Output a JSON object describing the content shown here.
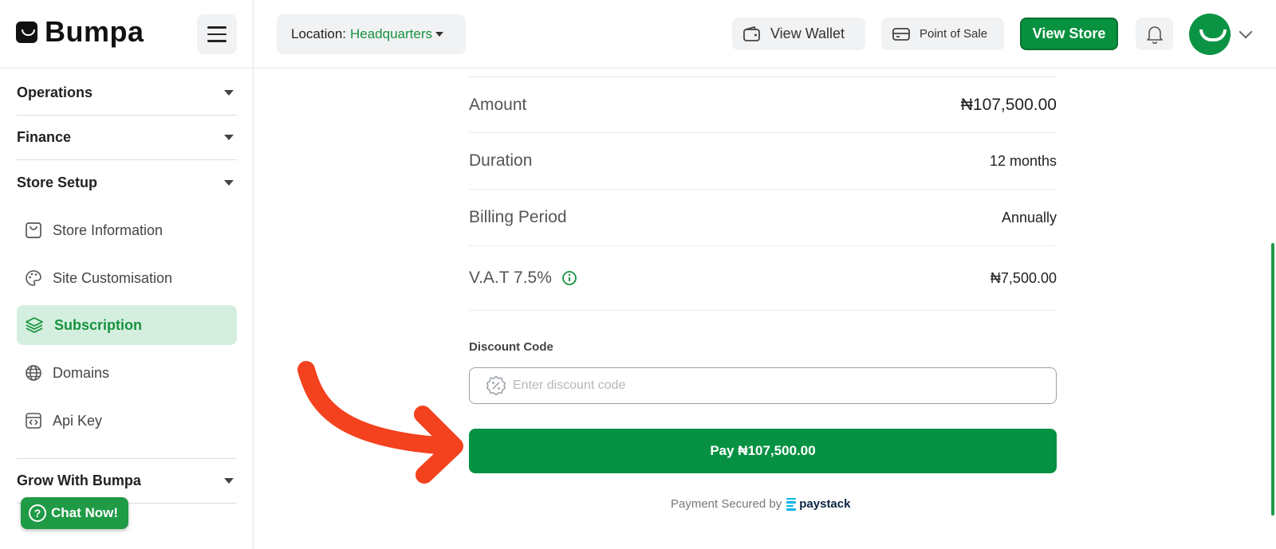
{
  "brand": {
    "name": "Bumpa"
  },
  "header": {
    "location_label": "Location:",
    "location_value": "Headquarters",
    "wallet_label": "View Wallet",
    "pos_label": "Point of Sale",
    "store_label": "View Store"
  },
  "sidebar": {
    "sections": [
      {
        "label": "Operations"
      },
      {
        "label": "Finance"
      },
      {
        "label": "Store Setup"
      },
      {
        "label": "Grow With Bumpa"
      }
    ],
    "items": [
      {
        "label": "Store Information",
        "icon": "store-icon"
      },
      {
        "label": "Site Customisation",
        "icon": "palette-icon"
      },
      {
        "label": "Subscription",
        "icon": "layers-icon",
        "active": true
      },
      {
        "label": "Domains",
        "icon": "globe-icon"
      },
      {
        "label": "Api Key",
        "icon": "code-icon"
      }
    ],
    "chat_label": "Chat Now!"
  },
  "summary": {
    "amount_label": "Amount",
    "amount_value": "₦107,500.00",
    "duration_label": "Duration",
    "duration_value": "12 months",
    "billing_label": "Billing Period",
    "billing_value": "Annually",
    "vat_label": "V.A.T 7.5%",
    "vat_value": "₦7,500.00"
  },
  "discount": {
    "label": "Discount Code",
    "placeholder": "Enter discount code"
  },
  "pay": {
    "label": "Pay ₦107,500.00",
    "secured_label": "Payment Secured by",
    "provider": "paystack"
  },
  "colors": {
    "brand_green": "#069143",
    "active_bg": "#d4efdf",
    "annotation_arrow": "#f4421e"
  }
}
